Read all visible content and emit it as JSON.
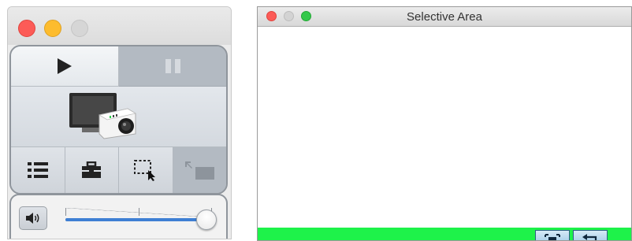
{
  "selective_window": {
    "title": "Selective Area"
  },
  "control_window": {
    "playback": {
      "play": "play",
      "pause": "pause"
    },
    "volume": {
      "level": 0.97
    }
  },
  "colors": {
    "selection_border": "#1ef24a",
    "volume_fill": "#3e7fd4",
    "close": "#fc5b57",
    "minimize": "#fdbc2e",
    "zoom": "#34c84a"
  }
}
